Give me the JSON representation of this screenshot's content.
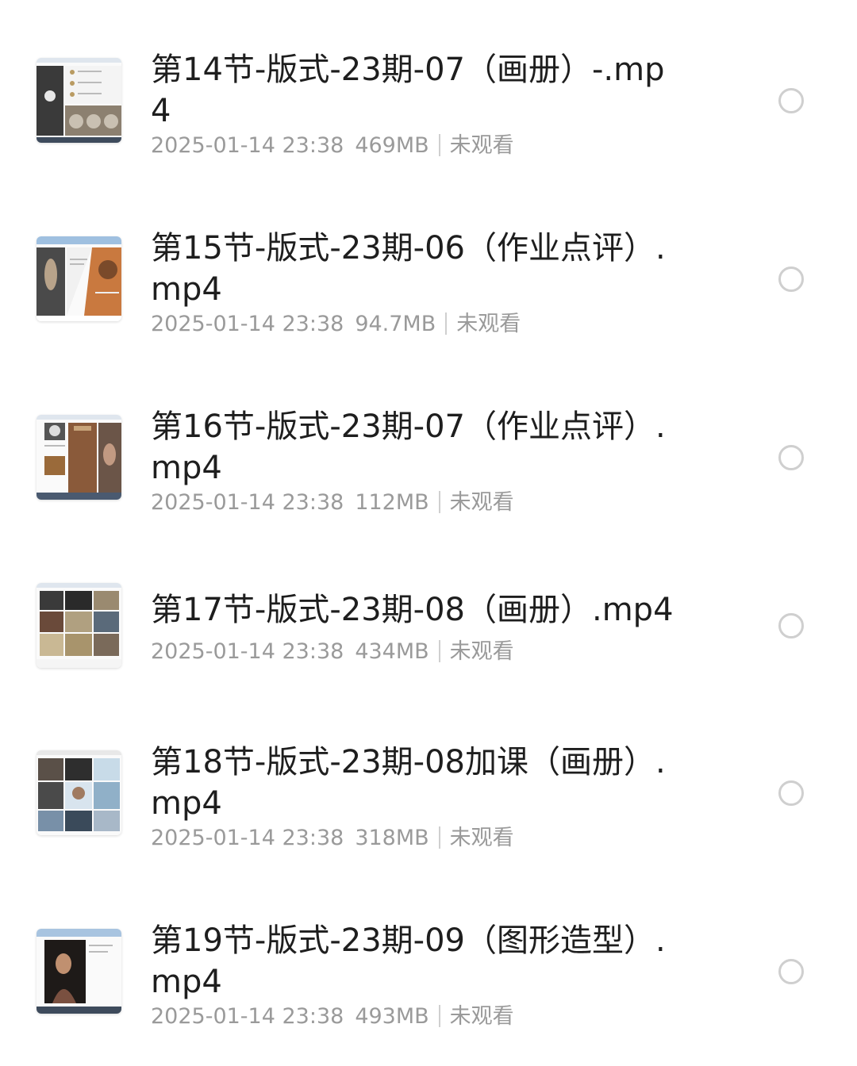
{
  "files": [
    {
      "title": "第14节-版式-23期-07（画册）-.mp4",
      "date": "2025-01-14 23:38",
      "size": "469MB",
      "status": "未观看",
      "thumbnail": "video-thumbnail",
      "selected": false
    },
    {
      "title": "第15节-版式-23期-06（作业点评）.mp4",
      "date": "2025-01-14 23:38",
      "size": "94.7MB",
      "status": "未观看",
      "thumbnail": "video-thumbnail",
      "selected": false
    },
    {
      "title": "第16节-版式-23期-07（作业点评）.mp4",
      "date": "2025-01-14 23:38",
      "size": "112MB",
      "status": "未观看",
      "thumbnail": "video-thumbnail",
      "selected": false
    },
    {
      "title": "第17节-版式-23期-08（画册）.mp4",
      "date": "2025-01-14 23:38",
      "size": "434MB",
      "status": "未观看",
      "thumbnail": "video-thumbnail",
      "selected": false
    },
    {
      "title": "第18节-版式-23期-08加课（画册）.mp4",
      "date": "2025-01-14 23:38",
      "size": "318MB",
      "status": "未观看",
      "thumbnail": "video-thumbnail",
      "selected": false
    },
    {
      "title": "第19节-版式-23期-09（图形造型）.mp4",
      "date": "2025-01-14 23:38",
      "size": "493MB",
      "status": "未观看",
      "thumbnail": "video-thumbnail",
      "selected": false
    }
  ],
  "colors": {
    "title": "#1e1e1e",
    "meta": "#9a9a9a",
    "radio_border": "#cfcfcf"
  }
}
